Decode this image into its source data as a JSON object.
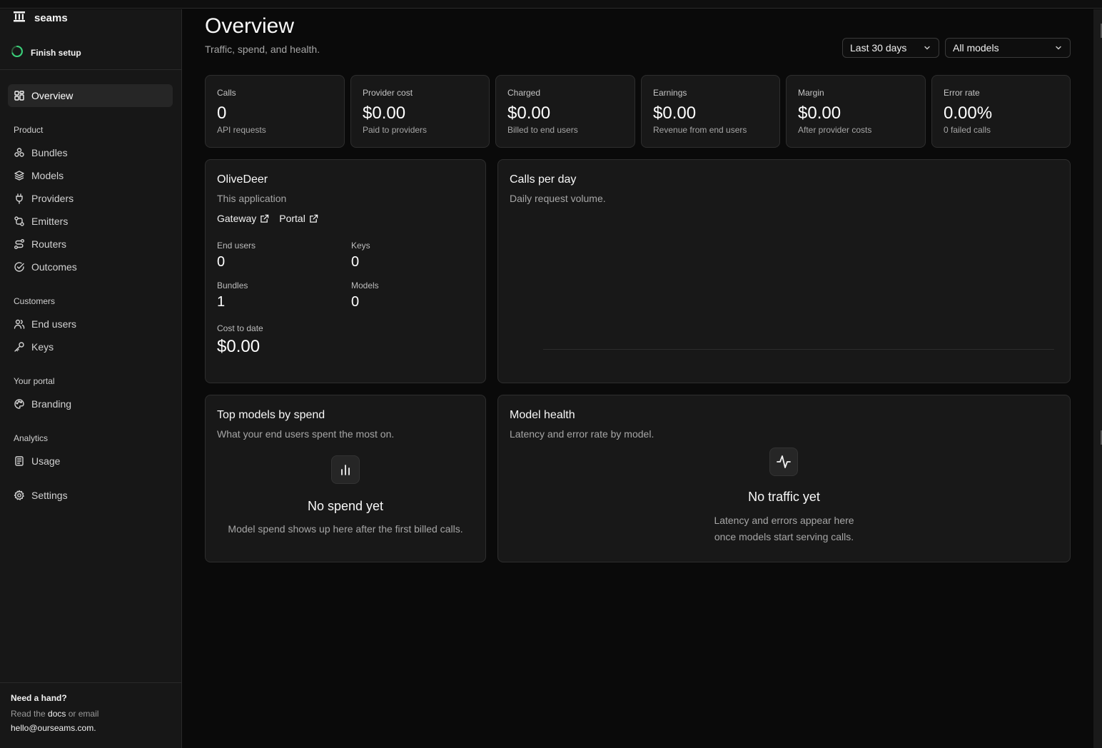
{
  "brand": {
    "name": "seams"
  },
  "setup": {
    "label": "Finish setup"
  },
  "nav": {
    "overview": "Overview",
    "sections": {
      "product": "Product",
      "customers": "Customers",
      "portal": "Your portal",
      "analytics": "Analytics"
    },
    "items": {
      "bundles": "Bundles",
      "models": "Models",
      "providers": "Providers",
      "emitters": "Emitters",
      "routers": "Routers",
      "outcomes": "Outcomes",
      "end_users": "End users",
      "keys": "Keys",
      "branding": "Branding",
      "usage": "Usage",
      "settings": "Settings"
    }
  },
  "help": {
    "title": "Need a hand?",
    "line1_prefix": "Read the ",
    "docs": "docs",
    "line1_suffix": " or email",
    "email": "hello@ourseams.com."
  },
  "header": {
    "title": "Overview",
    "subtitle": "Traffic, spend, and health.",
    "range": "Last 30 days",
    "models": "All models"
  },
  "kpis": [
    {
      "label": "Calls",
      "value": "0",
      "sub": "API requests"
    },
    {
      "label": "Provider cost",
      "value": "$0.00",
      "sub": "Paid to providers"
    },
    {
      "label": "Charged",
      "value": "$0.00",
      "sub": "Billed to end users"
    },
    {
      "label": "Earnings",
      "value": "$0.00",
      "sub": "Revenue from end users"
    },
    {
      "label": "Margin",
      "value": "$0.00",
      "sub": "After provider costs"
    },
    {
      "label": "Error rate",
      "value": "0.00%",
      "sub": "0 failed calls"
    }
  ],
  "app": {
    "name": "OliveDeer",
    "subtitle": "This application",
    "gateway": "Gateway",
    "portal": "Portal",
    "end_users_label": "End users",
    "end_users": "0",
    "keys_label": "Keys",
    "keys": "0",
    "bundles_label": "Bundles",
    "bundles": "1",
    "models_label": "Models",
    "models": "0",
    "cost_label": "Cost to date",
    "cost": "$0.00"
  },
  "calls_chart": {
    "title": "Calls per day",
    "subtitle": "Daily request volume."
  },
  "top_models": {
    "title": "Top models by spend",
    "subtitle": "What your end users spent the most on.",
    "empty_title": "No spend yet",
    "empty_text": "Model spend shows up here after the first billed calls."
  },
  "model_health": {
    "title": "Model health",
    "subtitle": "Latency and error rate by model.",
    "empty_title": "No traffic yet",
    "empty_line1": "Latency and errors appear here",
    "empty_line2": "once models start serving calls."
  }
}
